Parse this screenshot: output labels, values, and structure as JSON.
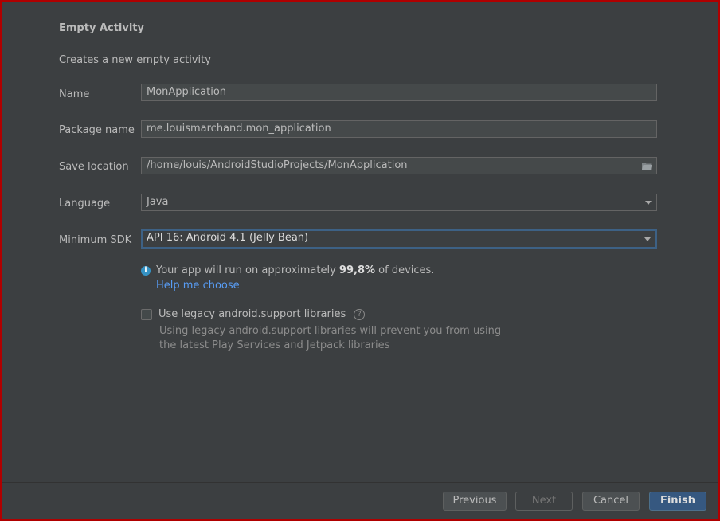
{
  "header": {
    "title": "Empty Activity",
    "subtitle": "Creates a new empty activity"
  },
  "form": {
    "name_label": "Name",
    "name_value": "MonApplication",
    "package_label": "Package name",
    "package_value": "me.louismarchand.mon_application",
    "location_label": "Save location",
    "location_value": "/home/louis/AndroidStudioProjects/MonApplication",
    "language_label": "Language",
    "language_value": "Java",
    "min_sdk_label": "Minimum SDK",
    "min_sdk_value": "API 16: Android 4.1 (Jelly Bean)"
  },
  "info": {
    "prefix": "Your app will run on approximately ",
    "percent": "99,8%",
    "suffix": " of devices.",
    "help_link": "Help me choose"
  },
  "legacy": {
    "checkbox_label": "Use legacy android.support libraries",
    "checked": false,
    "hint_line1": "Using legacy android.support libraries will prevent you from using",
    "hint_line2": "the latest Play Services and Jetpack libraries"
  },
  "buttons": {
    "previous": "Previous",
    "next": "Next",
    "cancel": "Cancel",
    "finish": "Finish"
  },
  "colors": {
    "background": "#3c3f41",
    "accent": "#365880",
    "link": "#589df6",
    "focus_border": "#3d6185",
    "window_border": "#b00000"
  },
  "icons": [
    "folder-icon",
    "chevron-down-icon",
    "info-icon",
    "help-icon"
  ]
}
